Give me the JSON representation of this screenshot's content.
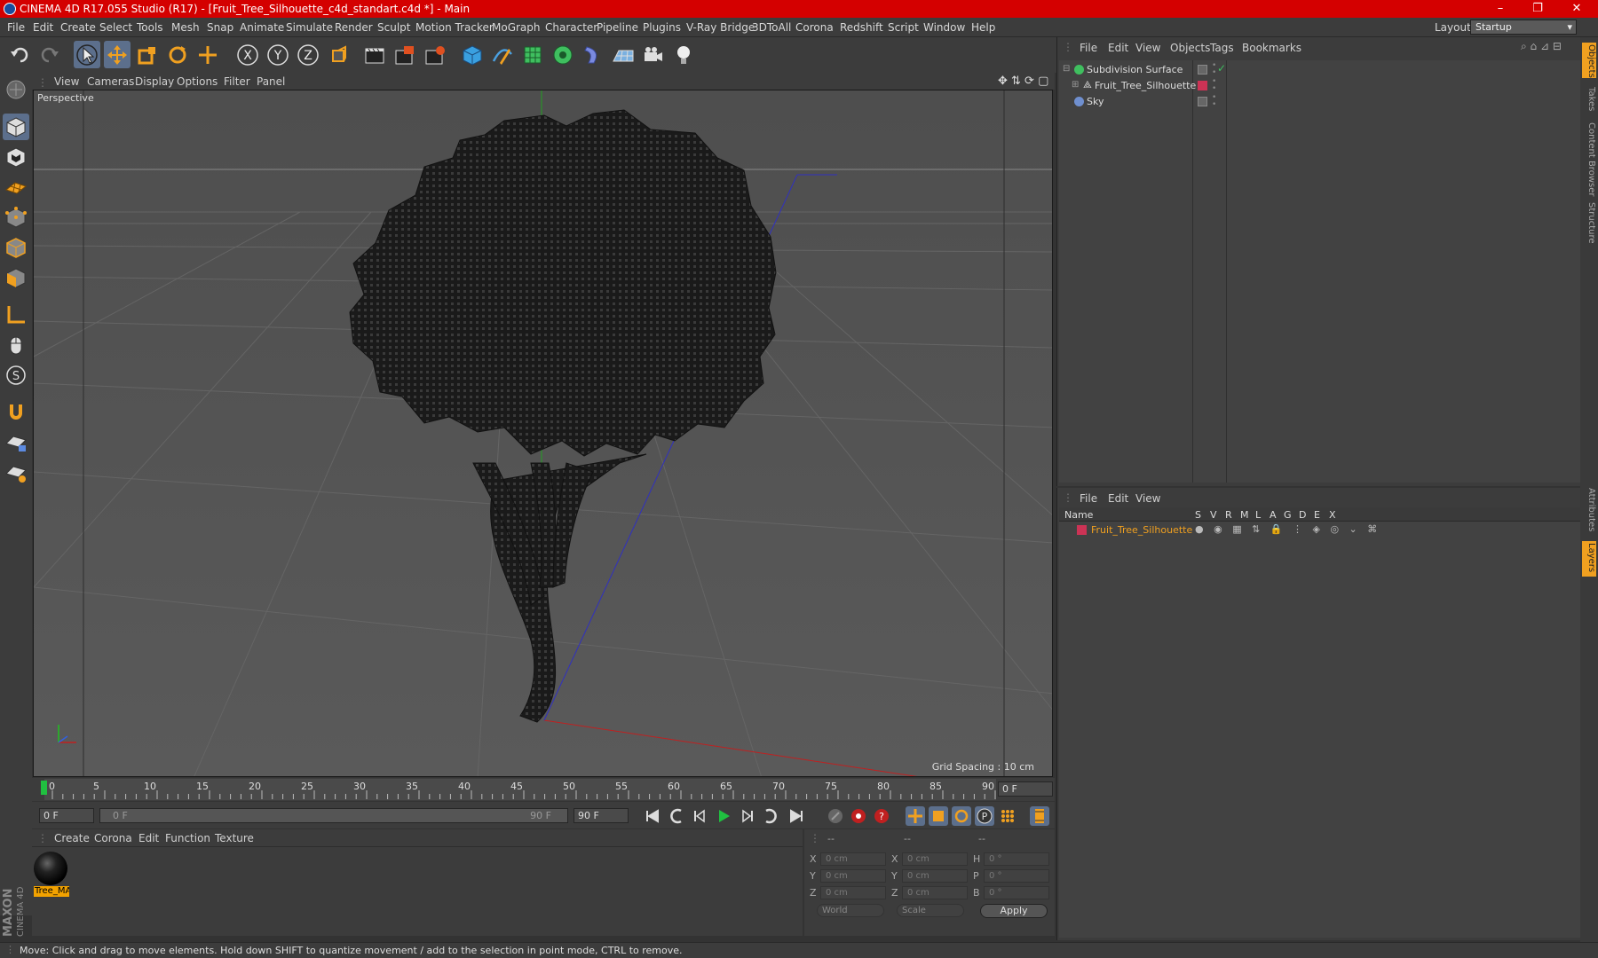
{
  "window": {
    "title": "CINEMA 4D R17.055 Studio (R17) - [Fruit_Tree_Silhouette_c4d_standart.c4d *] - Main",
    "controls": [
      "–",
      "❐",
      "✕"
    ]
  },
  "menubar": {
    "items": [
      "File",
      "Edit",
      "Create",
      "Select",
      "Tools",
      "Mesh",
      "Snap",
      "Animate",
      "Simulate",
      "Render",
      "Sculpt",
      "Motion Tracker",
      "MoGraph",
      "Character",
      "Pipeline",
      "Plugins",
      "V-Ray Bridge",
      "3DToAll",
      "Corona",
      "Redshift",
      "Script",
      "Window",
      "Help"
    ],
    "layout_label": "Layout:",
    "layout_value": "Startup"
  },
  "toolbar": {
    "icons": [
      "undo-icon",
      "redo-icon",
      "select-arrow-icon",
      "move-icon",
      "scale-icon",
      "rotate-icon",
      "add-icon",
      "x-axis-icon",
      "y-axis-icon",
      "z-axis-icon",
      "coordinate-system-icon",
      "render-view-icon",
      "render-picture-viewer-icon",
      "edit-render-settings-icon",
      "cube-icon",
      "pen-icon",
      "subdivision-icon",
      "cloner-icon",
      "deformer-icon",
      "floor-icon",
      "camera-icon",
      "light-icon"
    ],
    "axis_labels": [
      "X",
      "Y",
      "Z"
    ]
  },
  "viewport": {
    "menu": [
      "View",
      "Cameras",
      "Display",
      "Options",
      "Filter",
      "Panel"
    ],
    "label": "Perspective",
    "grid_spacing": "Grid Spacing : 10 cm",
    "accent": "#d8d800"
  },
  "timeline": {
    "ticks": [
      "0",
      "5",
      "10",
      "15",
      "20",
      "25",
      "30",
      "35",
      "40",
      "45",
      "50",
      "55",
      "60",
      "65",
      "70",
      "75",
      "80",
      "85",
      "90"
    ],
    "current_frame": "0 F",
    "start_field": "0 F",
    "slider_start": "0 F",
    "slider_end": "90 F",
    "end_field": "90 F"
  },
  "material_panel": {
    "menu": [
      "Create",
      "Corona",
      "Edit",
      "Function",
      "Texture"
    ],
    "material_name": "Tree_MAT"
  },
  "coords": {
    "headers": [
      "--",
      "--",
      "--"
    ],
    "rows": [
      {
        "a": "X",
        "av": "0 cm",
        "b": "X",
        "bv": "0 cm",
        "c": "H",
        "cv": "0 °"
      },
      {
        "a": "Y",
        "av": "0 cm",
        "b": "Y",
        "bv": "0 cm",
        "c": "P",
        "cv": "0 °"
      },
      {
        "a": "Z",
        "av": "0 cm",
        "b": "Z",
        "bv": "0 cm",
        "c": "B",
        "cv": "0 °"
      }
    ],
    "mode1": "World",
    "mode2": "Scale",
    "apply": "Apply"
  },
  "objects_panel": {
    "menu": [
      "File",
      "Edit",
      "View",
      "Objects",
      "Tags",
      "Bookmarks"
    ],
    "objects": [
      {
        "name": "Subdivision Surface",
        "color": "#3fbf5f"
      },
      {
        "name": "Fruit_Tree_Silhouette",
        "color": "#cccccc"
      },
      {
        "name": "Sky",
        "color": "#6f8fcf"
      }
    ]
  },
  "layers_panel": {
    "menu": [
      "File",
      "Edit",
      "View"
    ],
    "headers": [
      "Name",
      "S",
      "V",
      "R",
      "M",
      "L",
      "A",
      "G",
      "D",
      "E",
      "X"
    ],
    "layer_name": "Fruit_Tree_Silhouette",
    "layer_color": "#cc3333"
  },
  "right_tabs": [
    "Objects",
    "Takes",
    "Content Browser",
    "Structure",
    "Attributes",
    "Layers"
  ],
  "status": "Move: Click and drag to move elements. Hold down SHIFT to quantize movement / add to the selection in point mode, CTRL to remove.",
  "brand": "MAXON CINEMA 4D"
}
